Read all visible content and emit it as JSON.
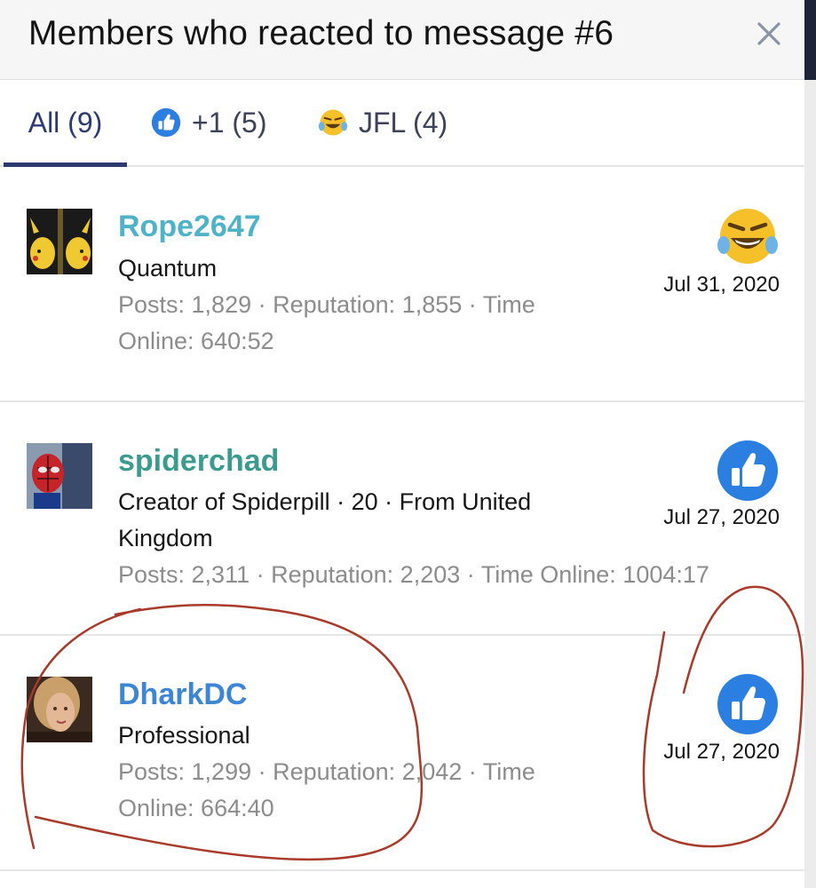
{
  "header": {
    "title": "Members who reacted to message #6"
  },
  "tabs": [
    {
      "label": "All (9)",
      "active": true
    },
    {
      "label": "+1 (5)",
      "icon": "thumbs-up-icon"
    },
    {
      "label": "JFL (4)",
      "icon": "laughing-crying-emoji-icon"
    }
  ],
  "members": [
    {
      "username": "Rope2647",
      "username_color": "#4fb3c8",
      "title_line1": "Quantum",
      "title_line2": "",
      "stats_line1": "Posts: 1,829 · Reputation: 1,855 · Time",
      "stats_line2": "Online: 640:52",
      "reaction": "laughing-crying-emoji-icon",
      "date": "Jul 31, 2020"
    },
    {
      "username": "spiderchad",
      "username_color": "#3b9b8f",
      "title_line1": "Creator of Spiderpill · 20 · From United",
      "title_line2": "Kingdom",
      "stats_line1": "Posts: 2,311 · Reputation: 2,203 · Time Online: 1004:17",
      "stats_line2": "",
      "reaction": "thumbs-up-icon",
      "date": "Jul 27, 2020"
    },
    {
      "username": "DharkDC",
      "username_color": "#3d86d6",
      "title_line1": "Professional",
      "title_line2": "",
      "stats_line1": "Posts: 1,299 · Reputation: 2,042 · Time",
      "stats_line2": "Online: 664:40",
      "reaction": "thumbs-up-icon",
      "date": "Jul 27, 2020"
    }
  ],
  "colors": {
    "accent": "#2e3a6e",
    "like_blue": "#2b7fe0",
    "annotation_red": "#a83a2a"
  }
}
